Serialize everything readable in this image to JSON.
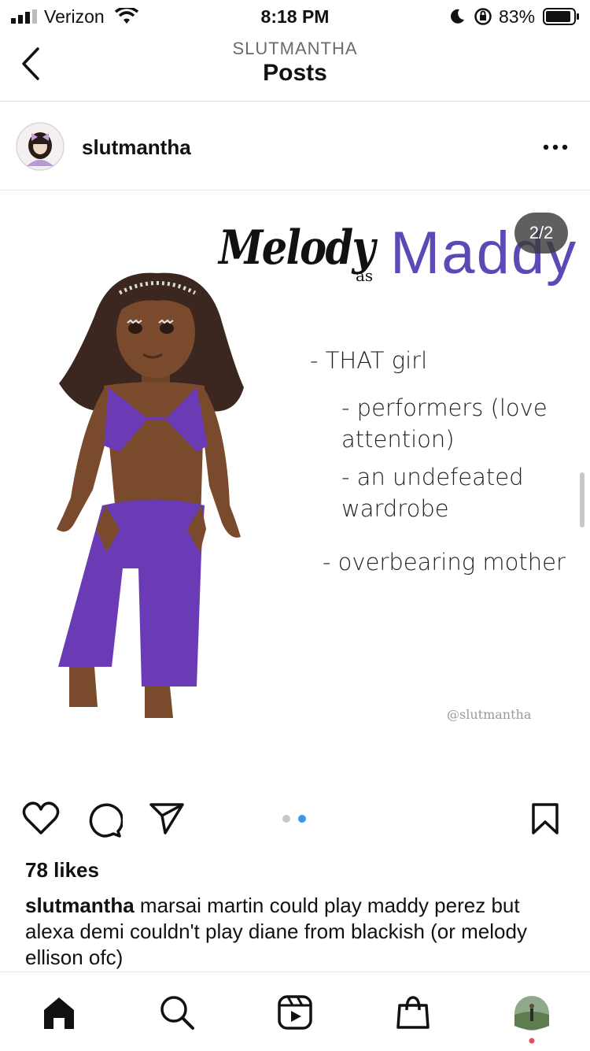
{
  "status_bar": {
    "carrier": "Verizon",
    "time": "8:18 PM",
    "battery_percent": "83%"
  },
  "header": {
    "subtitle": "SLUTMANTHA",
    "title": "Posts"
  },
  "post": {
    "username": "slutmantha",
    "image_counter": "2/2",
    "graphic": {
      "title_left": "Melody",
      "title_mid": "as",
      "title_right": "Maddy",
      "bullets": [
        "- THAT girl",
        "- performers (love attention)",
        "- an undefeated wardrobe",
        "- overbearing mother"
      ],
      "bullet_lines": {
        "b1": "- THAT girl",
        "b2a": "- performers (love",
        "b2b": "attention)",
        "b3a": "- an undefeated",
        "b3b": "wardrobe",
        "b4": "- overbearing mother"
      },
      "watermark": "@slutmantha"
    },
    "likes": "78 likes",
    "caption_user": "slutmantha",
    "caption_text": "marsai martin could play maddy perez but alexa demi couldn't play diane from blackish (or melody ellison ofc)",
    "carousel_active_index": 2,
    "carousel_total": 2
  },
  "colors": {
    "accent_blue": "#3897f0",
    "maddy_purple": "#5b49b8",
    "outfit_purple": "#6a3bb4",
    "notification_dot": "#ed4956"
  },
  "icons": [
    "back-chevron-icon",
    "more-options-icon",
    "heart-icon",
    "comment-icon",
    "share-icon",
    "bookmark-icon",
    "home-icon",
    "search-icon",
    "reels-icon",
    "shop-icon",
    "profile-avatar"
  ]
}
